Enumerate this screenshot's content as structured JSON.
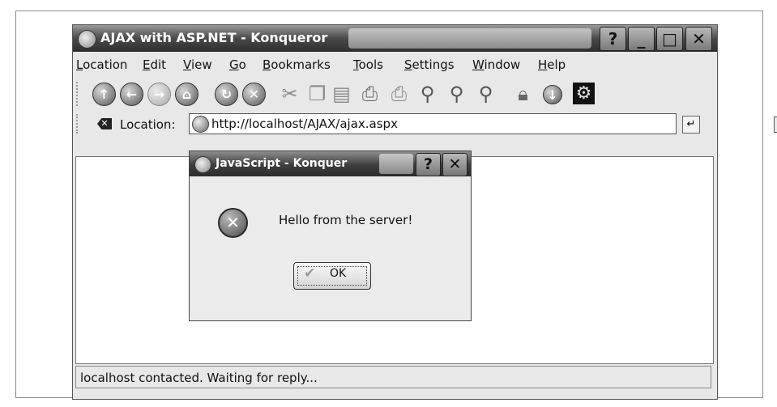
{
  "window": {
    "title": "AJAX with ASP.NET - Konqueror",
    "buttons": {
      "help": "?",
      "minimize": "_",
      "maximize": "□",
      "close": "✕"
    }
  },
  "menu": {
    "items": [
      {
        "label": "Location",
        "mnemonic": "L"
      },
      {
        "label": "Edit",
        "mnemonic": "E"
      },
      {
        "label": "View",
        "mnemonic": "V"
      },
      {
        "label": "Go",
        "mnemonic": "G"
      },
      {
        "label": "Bookmarks",
        "mnemonic": "B"
      },
      {
        "label": "Tools",
        "mnemonic": "T"
      },
      {
        "label": "Settings",
        "mnemonic": "S"
      },
      {
        "label": "Window",
        "mnemonic": "W"
      },
      {
        "label": "Help",
        "mnemonic": "H"
      }
    ]
  },
  "toolbar": {
    "icons": [
      "up-icon",
      "back-icon",
      "forward-icon",
      "home-icon",
      "reload-icon",
      "stop-icon",
      "cut-icon",
      "copy-icon",
      "paste-icon",
      "print-icon",
      "print-frame-icon",
      "zoom-icon",
      "zoom-in-icon",
      "zoom-out-icon",
      "security-lock-icon",
      "download-icon",
      "konqueror-gear-icon"
    ]
  },
  "location_bar": {
    "label": "Location:",
    "url": "http://localhost/AJAX/ajax.aspx"
  },
  "dialog": {
    "title": "JavaScript - Konquer",
    "message": "Hello from the server!",
    "ok_label": "OK",
    "buttons": {
      "help": "?",
      "close": "✕"
    }
  },
  "status": {
    "text": "localhost contacted. Waiting for reply..."
  }
}
